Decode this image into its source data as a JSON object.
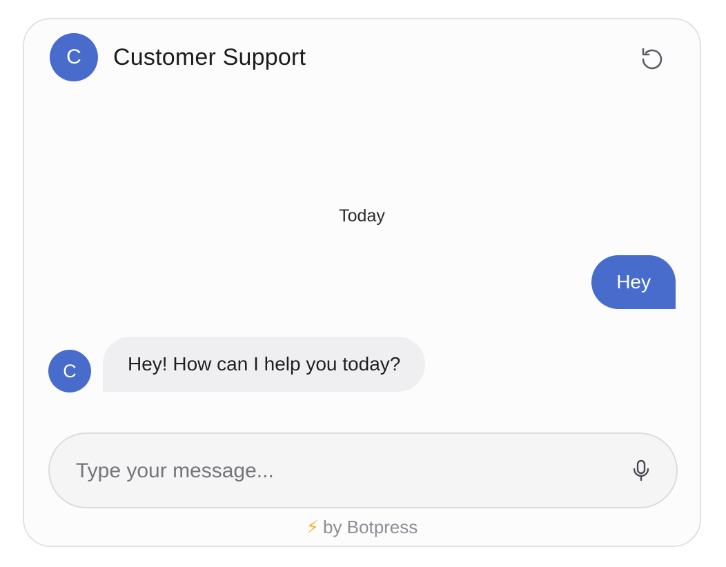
{
  "header": {
    "avatar_letter": "C",
    "title": "Customer Support",
    "refresh_icon": "refresh-icon"
  },
  "conversation": {
    "date_separator": "Today",
    "messages": [
      {
        "role": "user",
        "text": "Hey"
      },
      {
        "role": "bot",
        "avatar_letter": "C",
        "text": "Hey! How can I help you today?"
      }
    ]
  },
  "composer": {
    "placeholder": "Type your message...",
    "value": "",
    "mic_icon": "microphone-icon"
  },
  "footer": {
    "bolt_icon": "⚡",
    "text": "by Botpress"
  },
  "colors": {
    "accent": "#486ccb",
    "bot_bubble": "#efeff1",
    "bolt": "#e9b23b"
  }
}
